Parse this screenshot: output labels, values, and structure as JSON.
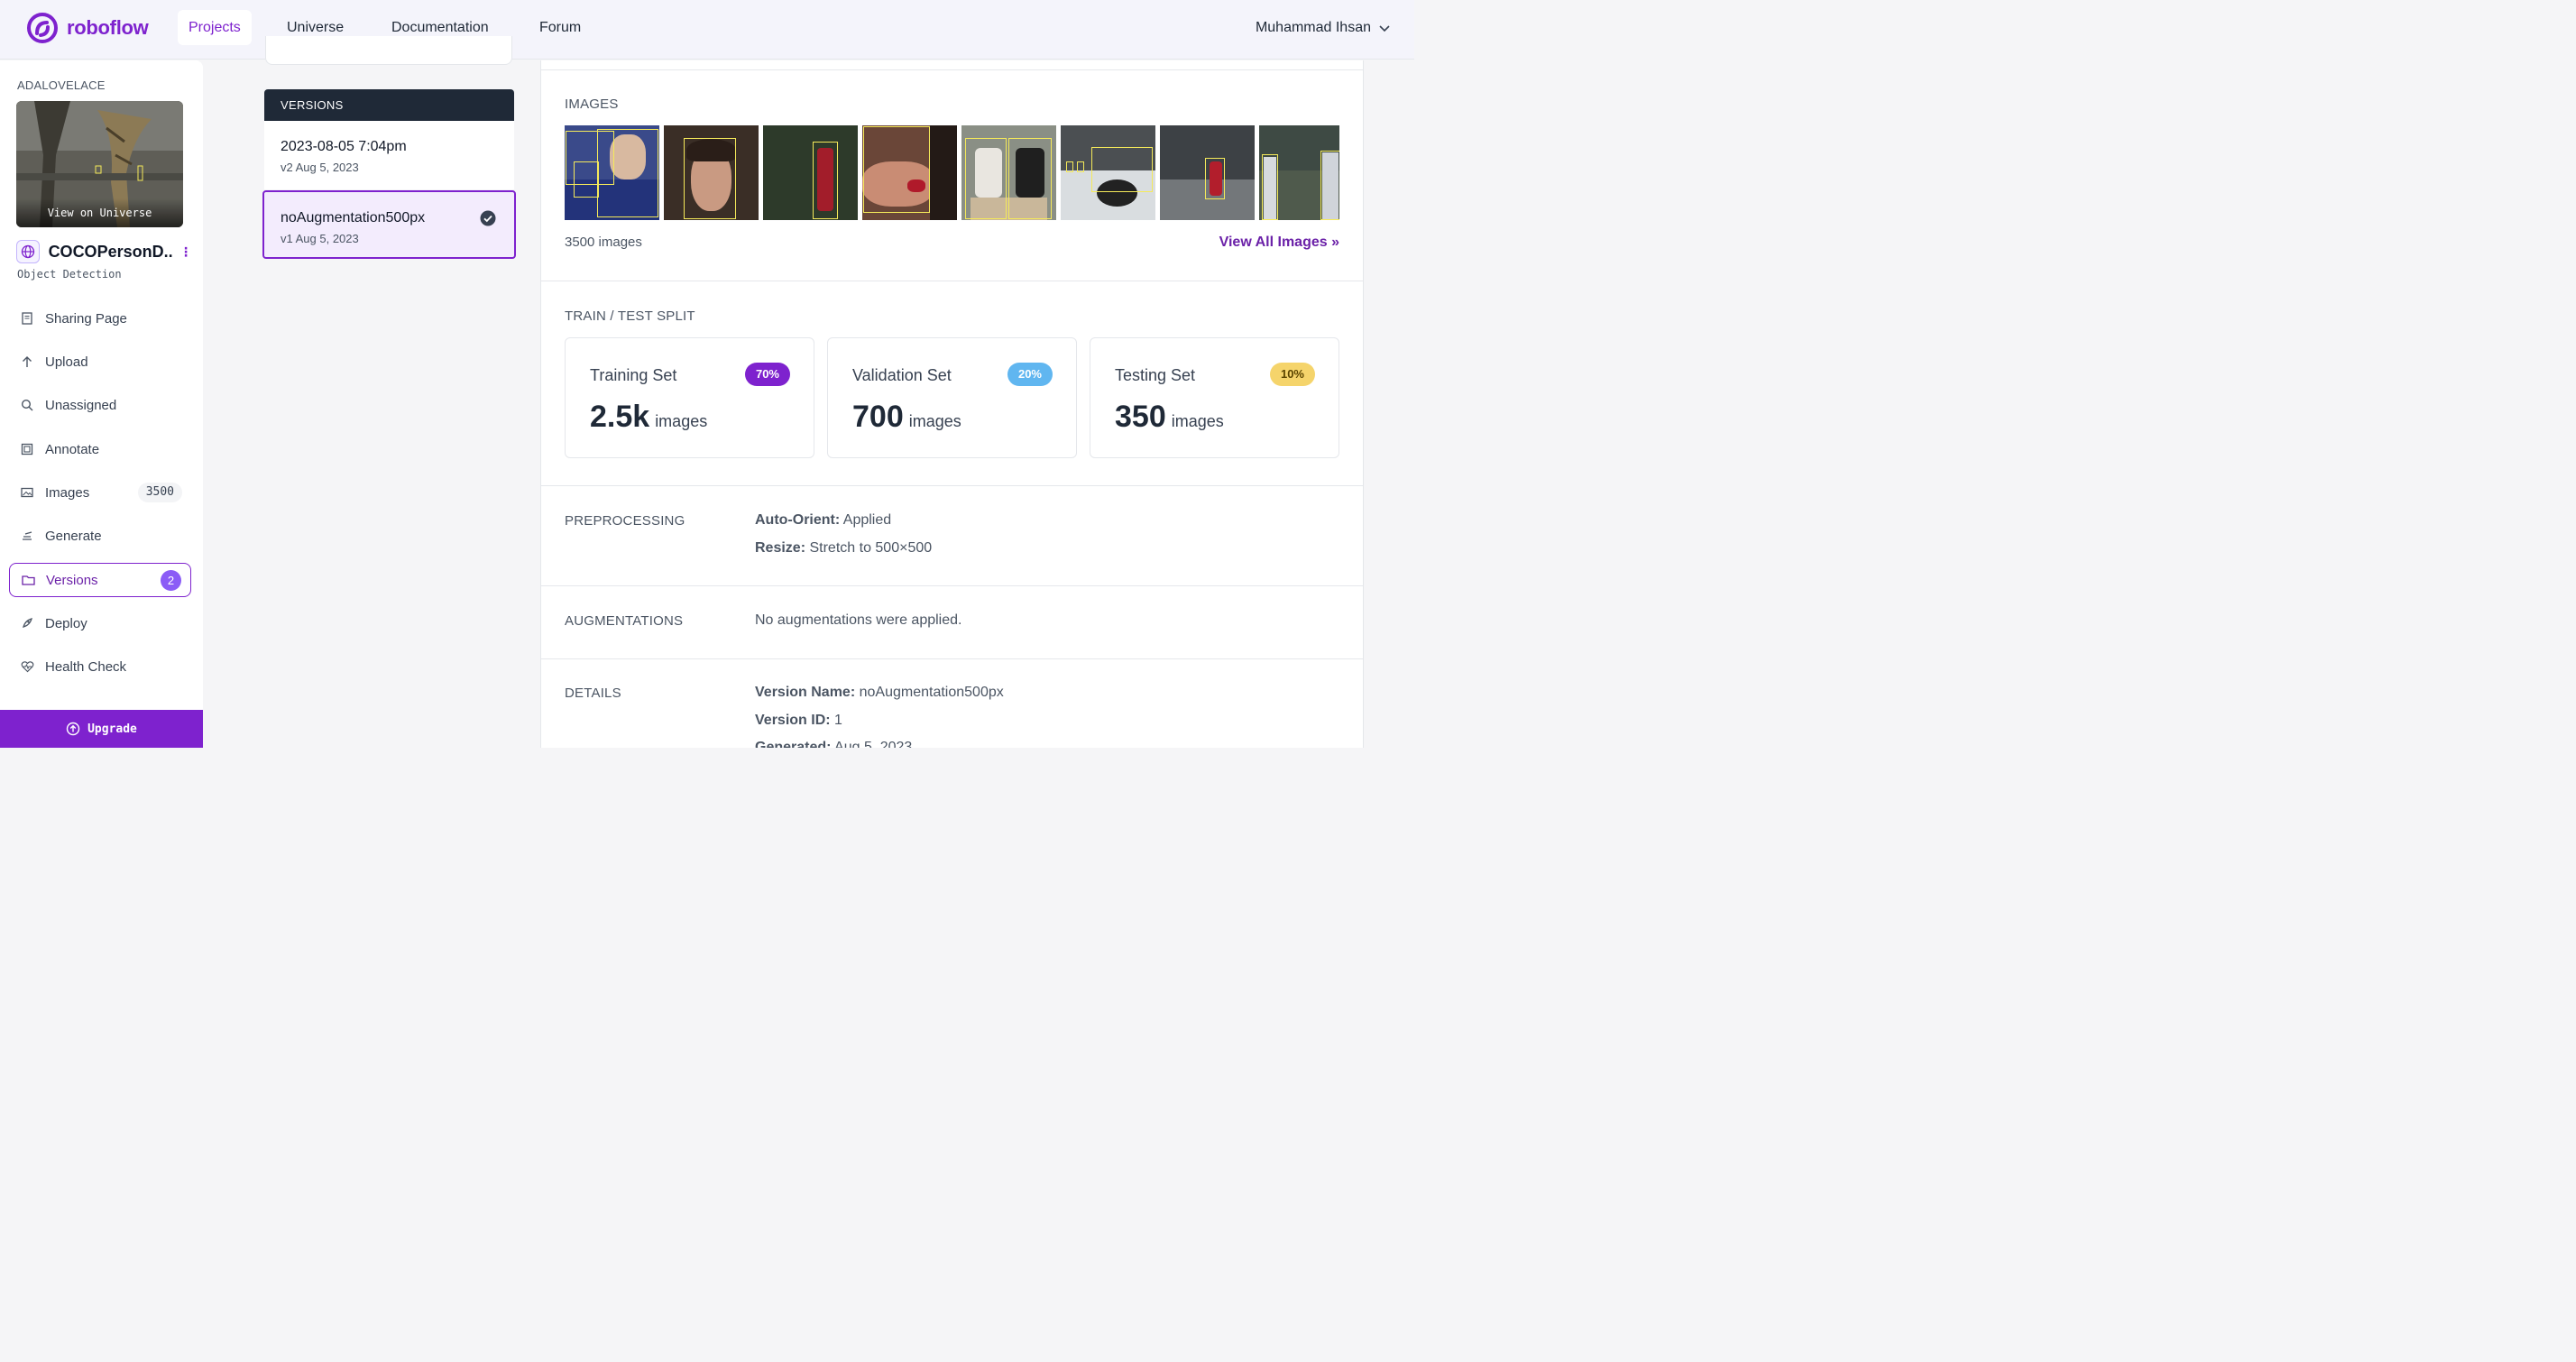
{
  "brand": {
    "name": "roboflow",
    "color": "#7e22ce"
  },
  "nav": {
    "items": [
      {
        "label": "Projects",
        "active": true
      },
      {
        "label": "Universe",
        "active": false
      },
      {
        "label": "Documentation",
        "active": false
      },
      {
        "label": "Forum",
        "active": false
      }
    ],
    "user": "Muhammad Ihsan"
  },
  "sidebar": {
    "workspace": "ADALOVELACE",
    "thumbnail_caption": "View on Universe",
    "project_name": "COCOPersonD...",
    "project_type": "Object Detection",
    "items": [
      {
        "label": "Sharing Page",
        "icon": "page-icon"
      },
      {
        "label": "Upload",
        "icon": "arrow-up-icon"
      },
      {
        "label": "Unassigned",
        "icon": "search-icon"
      },
      {
        "label": "Annotate",
        "icon": "annotate-icon"
      },
      {
        "label": "Images",
        "icon": "images-icon",
        "count": "3500"
      },
      {
        "label": "Generate",
        "icon": "generate-icon"
      },
      {
        "label": "Versions",
        "icon": "folder-icon",
        "count": "2",
        "active": true
      },
      {
        "label": "Deploy",
        "icon": "rocket-icon"
      },
      {
        "label": "Health Check",
        "icon": "heart-pulse-icon"
      }
    ],
    "upgrade_label": "Upgrade"
  },
  "versions": {
    "header": "VERSIONS",
    "list": [
      {
        "name": "2023-08-05 7:04pm",
        "meta": "v2 Aug 5, 2023",
        "selected": false
      },
      {
        "name": "noAugmentation500px",
        "meta": "v1 Aug 5, 2023",
        "selected": true
      }
    ]
  },
  "images_section": {
    "title": "IMAGES",
    "count_text": "3500 images",
    "view_all": "View All Images »"
  },
  "split": {
    "title": "TRAIN / TEST SPLIT",
    "cards": [
      {
        "label": "Training Set",
        "pct": "70%",
        "value": "2.5k",
        "unit": "images",
        "badge_bg": "#7e22ce",
        "badge_fg": "#ffffff"
      },
      {
        "label": "Validation Set",
        "pct": "20%",
        "value": "700",
        "unit": "images",
        "badge_bg": "#60b6f0",
        "badge_fg": "#ffffff"
      },
      {
        "label": "Testing Set",
        "pct": "10%",
        "value": "350",
        "unit": "images",
        "badge_bg": "#f5d46b",
        "badge_fg": "#5b4500"
      }
    ]
  },
  "preprocessing": {
    "title": "PREPROCESSING",
    "rows": [
      {
        "key": "Auto-Orient:",
        "value": "Applied"
      },
      {
        "key": "Resize:",
        "value": "Stretch to 500×500"
      }
    ]
  },
  "augmentations": {
    "title": "AUGMENTATIONS",
    "text": "No augmentations were applied."
  },
  "details": {
    "title": "DETAILS",
    "rows": [
      {
        "key": "Version Name:",
        "value": "noAugmentation500px"
      },
      {
        "key": "Version ID:",
        "value": "1"
      },
      {
        "key": "Generated:",
        "value": "Aug 5, 2023"
      }
    ]
  }
}
